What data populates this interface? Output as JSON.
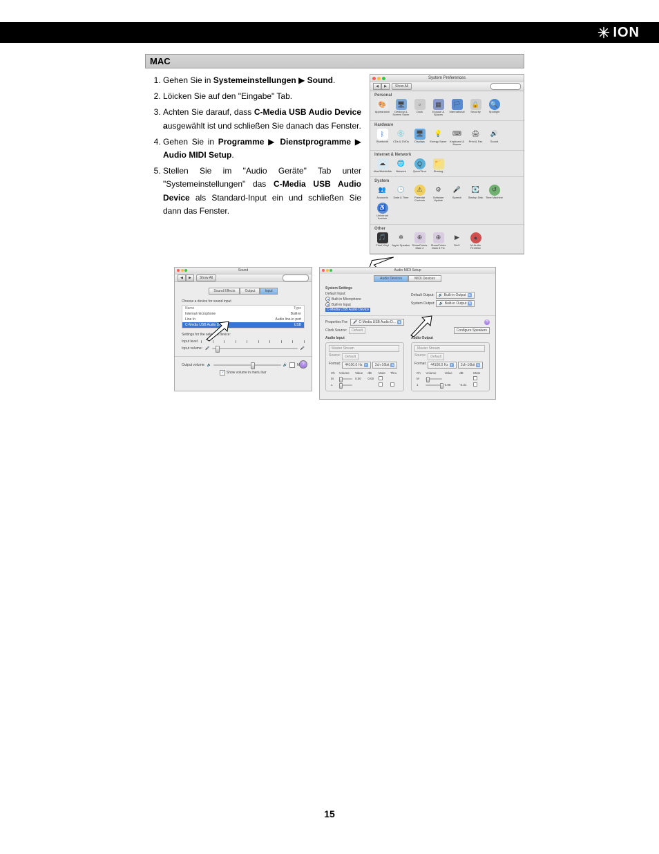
{
  "logo_text": "ION",
  "section_header": "MAC",
  "instructions": {
    "i1_a": "Gehen Sie in ",
    "i1_b": "Systemeinstellungen",
    "i1_c": " ▶ ",
    "i1_d": "Sound",
    "i1_e": ".",
    "i2": "Löicken Sie auf den \"Eingabe\" Tab.",
    "i3_a": "Achten Sie darauf, dass ",
    "i3_b": "C-Media USB Audio Device a",
    "i3_c": "usgewählt ist und schließen Sie danach das Fenster.",
    "i4_a": "Gehen Sie in ",
    "i4_b": "Programme",
    "i4_c": " ▶ ",
    "i4_d": "Dienstprogramme",
    "i4_e": " ▶ ",
    "i4_f": "Audio MIDI Setup",
    "i4_g": ".",
    "i5_a": "Stellen Sie im \"Audio Geräte\" Tab unter \"Systemeinstellungen\" das ",
    "i5_b": "C-Media USB Audio Device",
    "i5_c": " als Standard-Input ein und schließen Sie dann das Fenster."
  },
  "sysprefs": {
    "title": "System Preferences",
    "show_all": "Show All",
    "sections": {
      "personal": "Personal",
      "hardware": "Hardware",
      "internet": "Internet & Network",
      "system": "System",
      "other": "Other"
    },
    "items": {
      "appearance": "Appearance",
      "desktop": "Desktop & Screen Saver",
      "dock": "Dock",
      "expose": "Exposé & Spaces",
      "international": "International",
      "security": "Security",
      "spotlight": "Spotlight",
      "bluetooth": "Bluetooth",
      "cds": "CDs & DVDs",
      "displays": "Displays",
      "energy": "Energy Saver",
      "keyboard": "Keyboard & Mouse",
      "print": "Print & Fax",
      "sound": "Sound",
      "dotmac": ".Mac/MobileMe",
      "network": "Network",
      "quicktime": "QuickTime",
      "sharing": "Sharing",
      "accounts": "Accounts",
      "datetime": "Date & Time",
      "parental": "Parental Controls",
      "software": "Software Update",
      "speech": "Speech",
      "startup": "Startup Disk",
      "timemachine": "Time Machine",
      "universal": "Universal Access",
      "finalvinyl": "Final Vinyl",
      "apple_speaker": "Apple Speaker",
      "sharepoints": "SharePoints Main 2",
      "sharepoints2": "SharePoints Main 3 Fix",
      "divx": "DivX",
      "m_audio": "M-Audio FireWire"
    }
  },
  "sound": {
    "title": "Sound",
    "show_all": "Show All",
    "tabs": {
      "effects": "Sound Effects",
      "output": "Output",
      "input": "Input"
    },
    "choose": "Choose a device for sound input",
    "col_name": "Name",
    "col_type": "Type",
    "rows": {
      "r1n": "Internal microphone",
      "r1t": "Built-in",
      "r2n": "Line In",
      "r2t": "Audio line-in port",
      "r3n": "C-Media USB Audio Device",
      "r3t": "USB"
    },
    "settings": "Settings for the selected device:",
    "input_level": "Input level:",
    "input_volume": "Input volume:",
    "output_volume": "Output volume:",
    "mute": "Mute",
    "show_menu": "Show volume in menu bar"
  },
  "midi": {
    "title": "Audio MIDI Setup",
    "tabs": {
      "audio": "Audio Devices",
      "midi": "MIDI Devices"
    },
    "system_settings": "System Settings",
    "default_input": "Default Input:",
    "default_output": "Default Output:",
    "system_output": "System Output:",
    "opt_mic": "Built-in Microphone",
    "opt_linein": "Built-in Input",
    "opt_cmedia": "C-Media USB Audio Device",
    "opt_out": "Built-in Output",
    "properties_for": "Properties For:",
    "prop_val": "C-Media USB Audio D...",
    "clock_source": "Clock Source:",
    "clock_val": "Default",
    "configure_speakers": "Configure Speakers",
    "audio_input": "Audio Input",
    "audio_output": "Audio Output",
    "master_stream": "Master Stream",
    "source": "Source:",
    "source_val": "Default",
    "format": "Format:",
    "format_hz": "44100.0 Hz",
    "format_bits": "2ch-16bit",
    "ch": "Ch",
    "volume": "Volume",
    "value": "Value",
    "db": "dB",
    "mute_col": "Mute",
    "thru": "Thru",
    "m": "M",
    "one": "1",
    "val_m": "0.00",
    "db_m": "0.00",
    "val_1": "0.98",
    "db_1": "-0.31"
  },
  "page_number": "15"
}
